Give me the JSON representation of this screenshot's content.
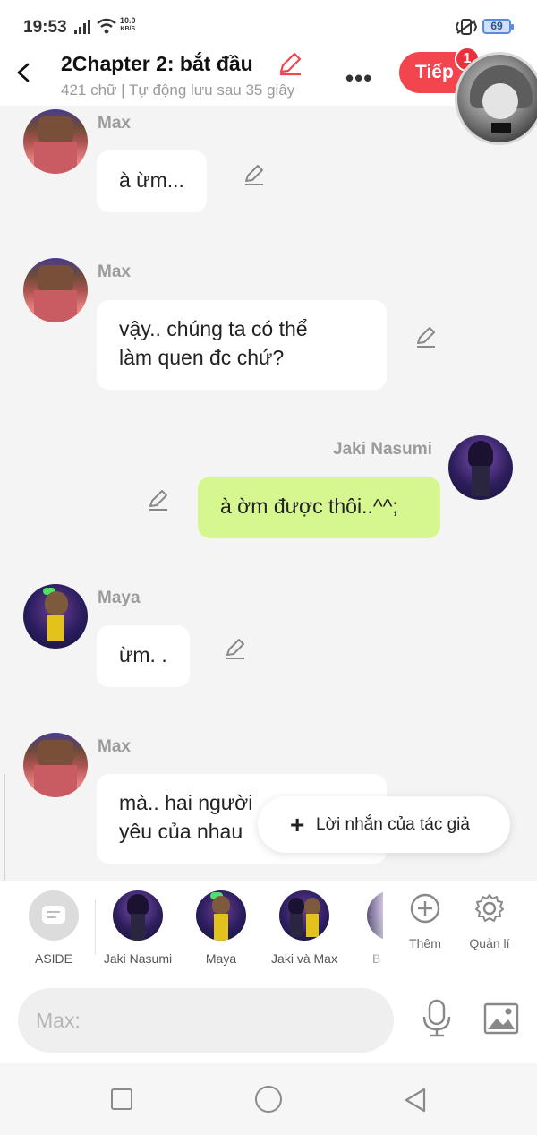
{
  "status": {
    "time": "19:53",
    "net_speed_value": "10.0",
    "net_speed_unit": "KB/S",
    "battery": "69"
  },
  "header": {
    "title": "2Chapter 2: bắt đầu",
    "subtitle": "421 chữ | Tự động lưu sau 35 giây",
    "next_label": "Tiếp",
    "next_badge": "1"
  },
  "messages": [
    {
      "sender": "Max",
      "text": "à ừm...",
      "side": "left"
    },
    {
      "sender": "Max",
      "text_line1": "vậy.. chúng ta có thể",
      "text_line2": "làm quen đc chứ?",
      "side": "left"
    },
    {
      "sender": "Jaki Nasumi",
      "text": "à ờm được thôi..^^;",
      "side": "right"
    },
    {
      "sender": "Maya",
      "text": "ừm. .",
      "side": "left"
    },
    {
      "sender": "Max",
      "text_line1": "mà.. hai người",
      "text_line2": "yêu của nhau",
      "side": "left"
    }
  ],
  "author_note": {
    "label": "Lời nhắn của tác giả"
  },
  "characters": [
    {
      "label": "ASIDE"
    },
    {
      "label": "Jaki Nasumi"
    },
    {
      "label": "Maya"
    },
    {
      "label": "Jaki và Max"
    },
    {
      "label": "B"
    }
  ],
  "tools": {
    "add_label": "Thêm",
    "manage_label": "Quản lí"
  },
  "input": {
    "placeholder": "Max:"
  },
  "colors": {
    "accent": "#f2454d",
    "my_bubble": "#d6f78f",
    "bubble": "#ffffff"
  }
}
